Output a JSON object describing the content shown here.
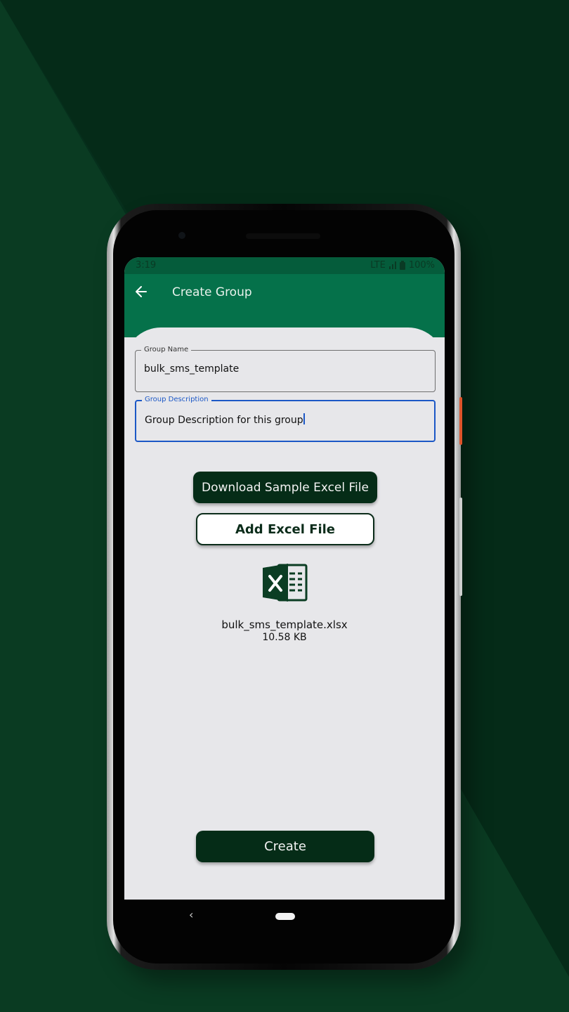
{
  "status": {
    "time": "3:19",
    "network": "LTE",
    "battery": "100%"
  },
  "appbar": {
    "title": "Create Group",
    "back_icon": "arrow-left-icon"
  },
  "form": {
    "group_name": {
      "label": "Group Name",
      "value": "bulk_sms_template"
    },
    "group_description": {
      "label": "Group Description",
      "value": "Group Description for this group"
    }
  },
  "buttons": {
    "download": "Download Sample Excel File",
    "add_file": "Add Excel File",
    "create": "Create"
  },
  "file": {
    "icon": "excel-file-icon",
    "name": "bulk_sms_template.xlsx",
    "size": "10.58 KB"
  },
  "navbar": {
    "back_icon": "nav-back-icon",
    "home_icon": "nav-home-pill-icon"
  },
  "colors": {
    "appbar": "#05714a",
    "dark_button": "#052c17",
    "focus": "#1c58c6",
    "background": "#062f1c"
  }
}
